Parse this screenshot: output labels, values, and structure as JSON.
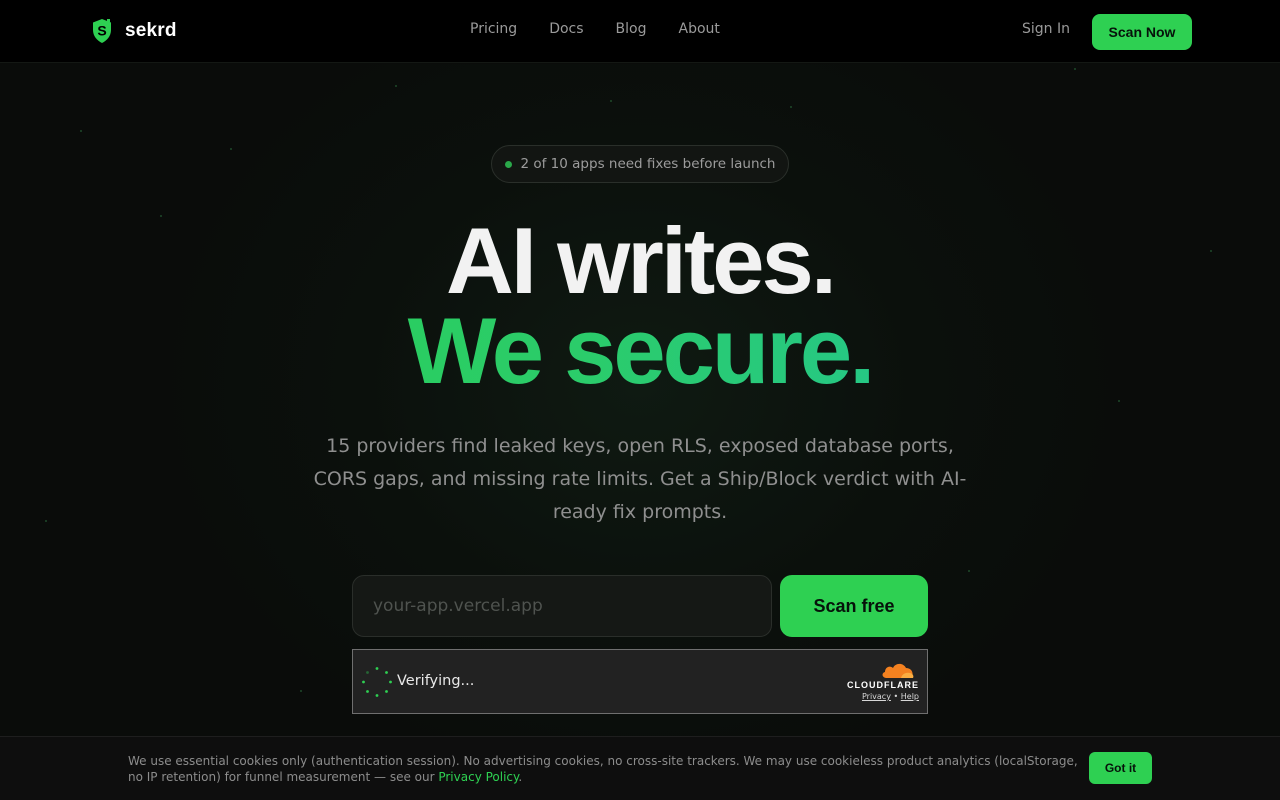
{
  "brand": {
    "name": "sekrd",
    "logo_icon": "shield-s-icon",
    "accent": "#2ed052"
  },
  "nav": {
    "links": [
      "Pricing",
      "Docs",
      "Blog",
      "About"
    ],
    "sign_in": "Sign In",
    "cta": "Scan Now"
  },
  "hero": {
    "pill_text": "2 of 10 apps need fixes before launch",
    "headline_line1": "AI writes.",
    "headline_line2": "We secure.",
    "subtitle": "15 providers find leaked keys, open RLS, exposed database ports, CORS gaps, and missing rate limits. Get a Ship/Block verdict with AI-ready fix prompts.",
    "input_placeholder": "your-app.vercel.app",
    "input_value": "",
    "submit_label": "Scan free"
  },
  "turnstile": {
    "status": "Verifying...",
    "provider": "CLOUDFLARE",
    "privacy": "Privacy",
    "separator": "•",
    "help": "Help"
  },
  "cookie_banner": {
    "text": "We use essential cookies only (authentication session). No advertising cookies, no cross-site trackers. We may use cookieless product analytics (localStorage, no IP retention) for funnel measurement — see our ",
    "link_label": "Privacy Policy",
    "link_suffix": ".",
    "accept_label": "Got it"
  }
}
